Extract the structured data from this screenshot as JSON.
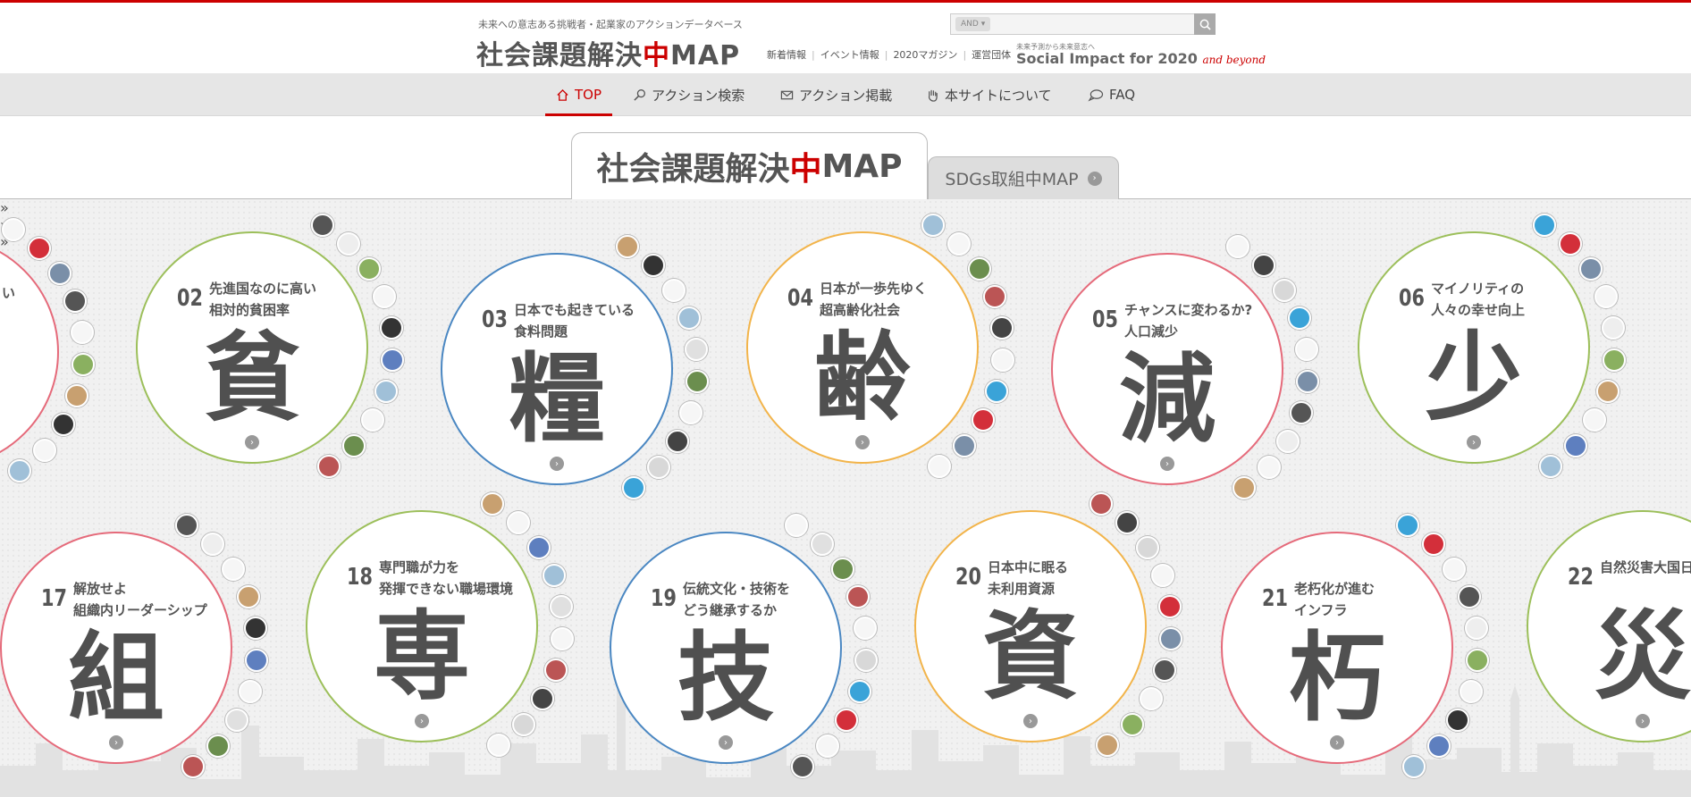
{
  "header": {
    "tagline": "未来への意志ある挑戦者・起業家のアクションデータベース",
    "logo_prefix": "社会課題解決",
    "logo_accent": "中",
    "logo_suffix": "MAP",
    "search": {
      "mode": "AND",
      "placeholder": ""
    },
    "links": [
      "新着情報",
      "イベント情報",
      "2020マガジン",
      "運営団体"
    ],
    "sponsor_sub": "未来予測から未来意志へ",
    "sponsor_main": "Social Impact for 2020",
    "sponsor_accent": "and beyond"
  },
  "nav": {
    "items": [
      {
        "label": "TOP",
        "icon": "home-icon",
        "active": true
      },
      {
        "label": "アクション検索",
        "icon": "search-icon",
        "active": false
      },
      {
        "label": "アクション掲載",
        "icon": "mail-icon",
        "active": false
      },
      {
        "label": "本サイトについて",
        "icon": "hand-icon",
        "active": false
      },
      {
        "label": "FAQ",
        "icon": "chat-icon",
        "active": false
      }
    ]
  },
  "tabs": {
    "main_prefix": "社会課題解決",
    "main_accent": "中",
    "main_suffix": "MAP",
    "sub": "SDGs取組中MAP"
  },
  "issues": [
    {
      "num": "",
      "line1": "",
      "line2": "い",
      "kanji": "",
      "color": "#e56a7a"
    },
    {
      "num": "02",
      "line1": "先進国なのに高い",
      "line2": "相対的貧困率",
      "kanji": "貧",
      "color": "#9cbf5a"
    },
    {
      "num": "03",
      "line1": "日本でも起きている",
      "line2": "食料問題",
      "kanji": "糧",
      "color": "#4a87c2"
    },
    {
      "num": "04",
      "line1": "日本が一歩先ゆく",
      "line2": "超高齢化社会",
      "kanji": "齢",
      "color": "#f2b44a"
    },
    {
      "num": "05",
      "line1": "チャンスに変わるか?",
      "line2": "人口減少",
      "kanji": "減",
      "color": "#e56a7a"
    },
    {
      "num": "06",
      "line1": "マイノリティの",
      "line2": "人々の幸せ向上",
      "kanji": "少",
      "color": "#9cbf5a"
    },
    {
      "num": "17",
      "line1": "解放せよ",
      "line2": "組織内リーダーシップ",
      "kanji": "組",
      "color": "#e56a7a"
    },
    {
      "num": "18",
      "line1": "専門職が力を",
      "line2": "発揮できない職場環境",
      "kanji": "専",
      "color": "#9cbf5a"
    },
    {
      "num": "19",
      "line1": "伝統文化・技術を",
      "line2": "どう継承するか",
      "kanji": "技",
      "color": "#4a87c2"
    },
    {
      "num": "20",
      "line1": "日本中に眠る",
      "line2": "未利用資源",
      "kanji": "資",
      "color": "#f2b44a"
    },
    {
      "num": "21",
      "line1": "老朽化が進む",
      "line2": "インフラ",
      "kanji": "朽",
      "color": "#e56a7a"
    },
    {
      "num": "22",
      "line1": "自然災害大国日",
      "line2": "",
      "kanji": "災",
      "color": "#9cbf5a"
    }
  ]
}
